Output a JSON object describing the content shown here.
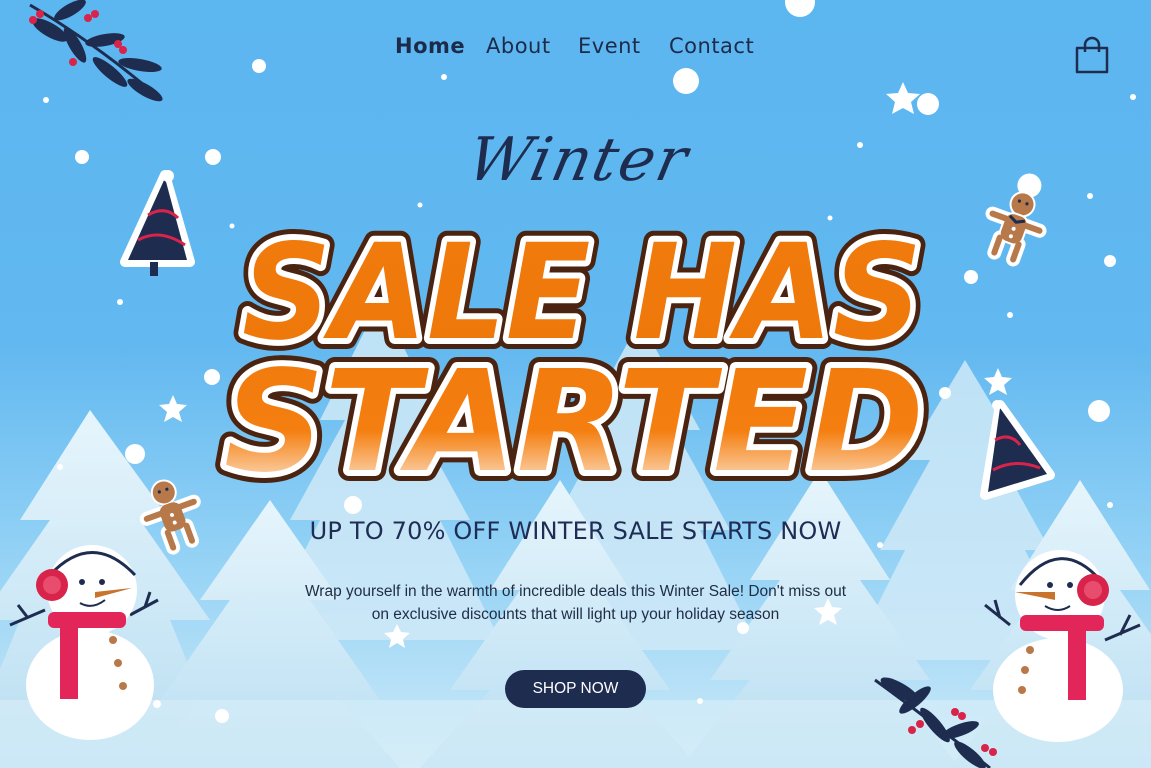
{
  "nav": {
    "items": [
      {
        "label": "Home"
      },
      {
        "label": "About"
      },
      {
        "label": "Event"
      },
      {
        "label": "Contact"
      }
    ],
    "cart_icon": "shopping-bag-icon"
  },
  "hero": {
    "script_title": "Winter",
    "headline_line1": "SALE HAS",
    "headline_line2": "STARTED",
    "subtitle": "UP TO 70% OFF WINTER SALE STARTS NOW",
    "description_line1": "Wrap yourself in the warmth of incredible deals this Winter Sale! Don't miss out",
    "description_line2": "on exclusive discounts that will light up your holiday season",
    "cta_label": "SHOP NOW"
  },
  "colors": {
    "sky": "#5cb6f0",
    "headline_orange": "#f07a0c",
    "headline_outline": "#4a2410",
    "navy": "#1e2c4f"
  }
}
